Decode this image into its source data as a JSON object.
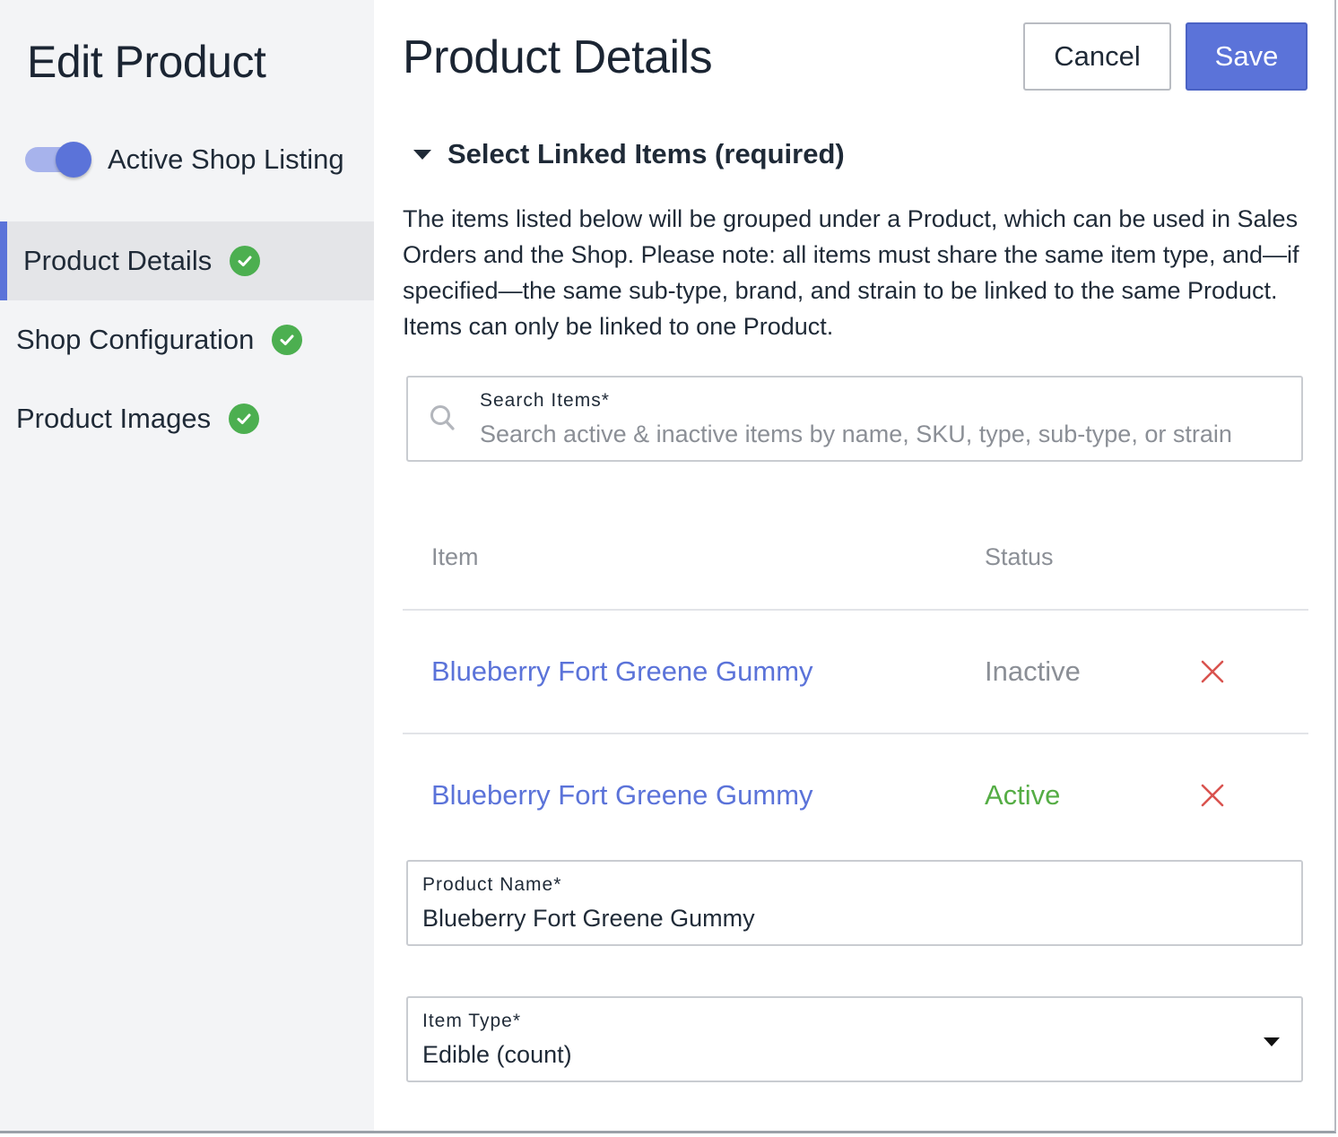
{
  "sidebar": {
    "title": "Edit Product",
    "toggle": {
      "label": "Active Shop Listing",
      "on": true
    },
    "items": [
      {
        "label": "Product Details",
        "complete": true,
        "active": true
      },
      {
        "label": "Shop Configuration",
        "complete": true,
        "active": false
      },
      {
        "label": "Product Images",
        "complete": true,
        "active": false
      }
    ]
  },
  "header": {
    "title": "Product Details",
    "cancel_label": "Cancel",
    "save_label": "Save"
  },
  "section": {
    "title": "Select Linked Items (required)",
    "description": "The items listed below will be grouped under a Product, which can be used in Sales Orders and the Shop. Please note: all items must share the same item type, and—if specified—the same sub-type, brand, and strain to be linked to the same Product. Items can only be linked to one Product."
  },
  "search": {
    "label": "Search Items*",
    "placeholder": "Search active & inactive items by name, SKU, type, sub-type, or strain"
  },
  "table": {
    "columns": [
      "Item",
      "Status"
    ],
    "rows": [
      {
        "item": "Blueberry Fort Greene Gummy",
        "status": "Inactive"
      },
      {
        "item": "Blueberry Fort Greene Gummy",
        "status": "Active"
      }
    ]
  },
  "product_name": {
    "label": "Product Name*",
    "value": "Blueberry Fort Greene Gummy"
  },
  "item_type": {
    "label": "Item Type*",
    "value": "Edible (count)"
  },
  "colors": {
    "accent": "#5b73d9",
    "success": "#4caf50",
    "active_status": "#55ad45",
    "inactive_status": "#8b8f96",
    "danger": "#d9534f"
  },
  "icons": {
    "section_toggle": "caret-down-icon",
    "complete": "check-circle-icon",
    "search": "search-icon",
    "remove": "close-icon",
    "dropdown": "chevron-down-icon"
  }
}
